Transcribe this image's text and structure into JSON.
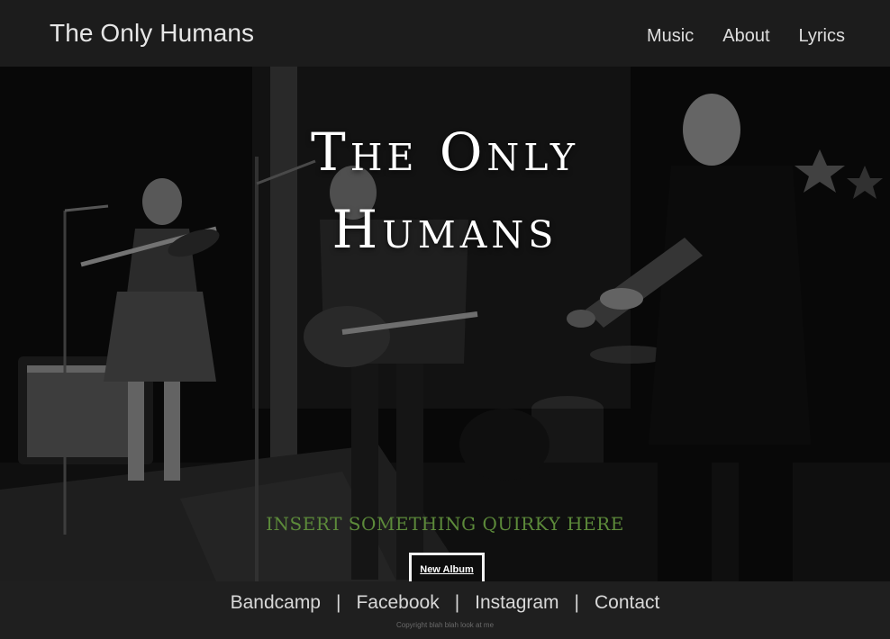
{
  "navbar": {
    "brand": "The Only Humans",
    "links": [
      {
        "label": "Music"
      },
      {
        "label": "About"
      },
      {
        "label": "Lyrics"
      }
    ]
  },
  "hero": {
    "title_line1": "The Only",
    "title_line2": "Humans",
    "tagline": "Insert something quirky here",
    "button_label": "New Album",
    "image_description_icon": "band-photo-image"
  },
  "footer": {
    "links": [
      {
        "label": "Bandcamp"
      },
      {
        "label": "Facebook"
      },
      {
        "label": "Instagram"
      },
      {
        "label": "Contact"
      }
    ],
    "separator": "|",
    "copyright": "Copyright blah blah look at me"
  },
  "colors": {
    "nav_bg": "#1c1c1c",
    "footer_bg": "#1f1f1f",
    "tagline": "#5c8a3a",
    "text": "#e6e6e6"
  }
}
